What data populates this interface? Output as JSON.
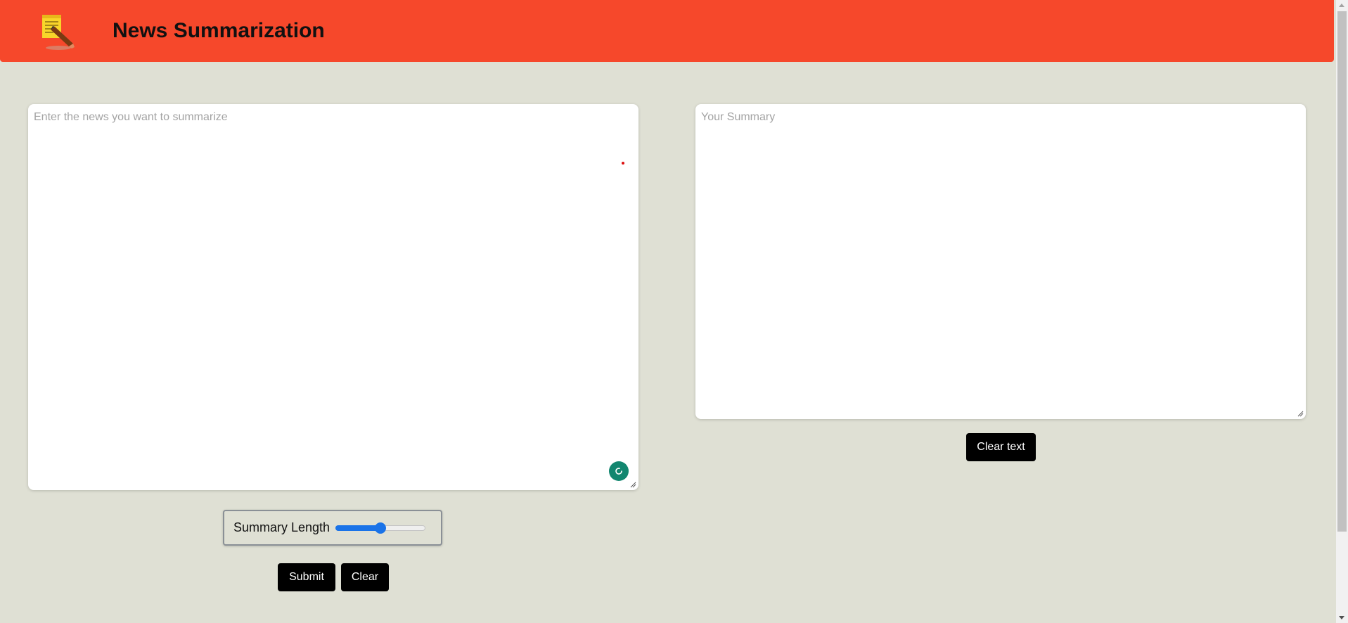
{
  "header": {
    "title": "News Summarization",
    "logo_icon": "notepad-pencil-icon",
    "background_color": "#f6482b"
  },
  "input": {
    "placeholder": "Enter the news you want to summarize",
    "value": ""
  },
  "output": {
    "placeholder": "Your Summary",
    "value": ""
  },
  "slider": {
    "label": "Summary Length",
    "fraction": 0.5,
    "accent_color": "#1a73e8"
  },
  "buttons": {
    "submit_label": "Submit",
    "clear_label": "Clear",
    "clear_text_label": "Clear text"
  },
  "colors": {
    "page_background": "#dfe0d4",
    "button_background": "#000000",
    "grammar_badge": "#12866f"
  }
}
